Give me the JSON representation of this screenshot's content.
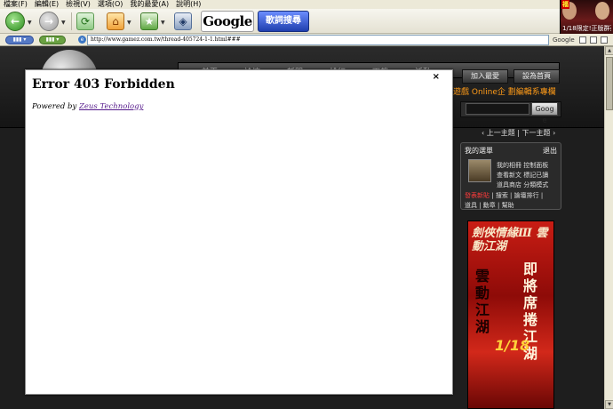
{
  "menubar": {
    "items": [
      "檔案(F)",
      "編輯(E)",
      "檢視(V)",
      "選項(O)",
      "我的最愛(A)",
      "說明(H)"
    ]
  },
  "ad": {
    "tag": "福",
    "text": "1/18限定!正版群英"
  },
  "toolbar": {
    "google_label": "Google",
    "music_label": "歌詞搜尋"
  },
  "addressbar": {
    "url": "http://www.gamez.com.tw/thread-405724-1-1.html###",
    "google_label": "Google"
  },
  "site": {
    "nav_items": [
      "首頁",
      "論壇",
      "新聞",
      "排行",
      "下載",
      "活動"
    ],
    "top_buttons": [
      "加入最愛",
      "設為首頁"
    ],
    "orange_text": "遊戲 Online企 劃編輯系專欄",
    "search_button": "Goog e",
    "pager": "‹ 上一主題 | 下一主題 ›",
    "info": {
      "title": "我的選單",
      "exit": "退出",
      "lines": [
        "我的相冊 控制面板",
        "查看新文 標記已讀",
        "道具商店 分類模式"
      ],
      "red_text": "發表新貼",
      "line_rest": "| 搜索 | 論壇排行 |",
      "line_last": "道具 | 勳章 | 幫助"
    },
    "banner": {
      "title": "劍俠情緣Ⅲ 雲動江湖",
      "left_text": "雲動江湖",
      "right_text": "即將席捲江湖",
      "promo": "1/18"
    }
  },
  "modal": {
    "close": "×",
    "title": "Error 403 Forbidden",
    "powered_prefix": "Powered by",
    "powered_link": "Zeus Technology"
  }
}
